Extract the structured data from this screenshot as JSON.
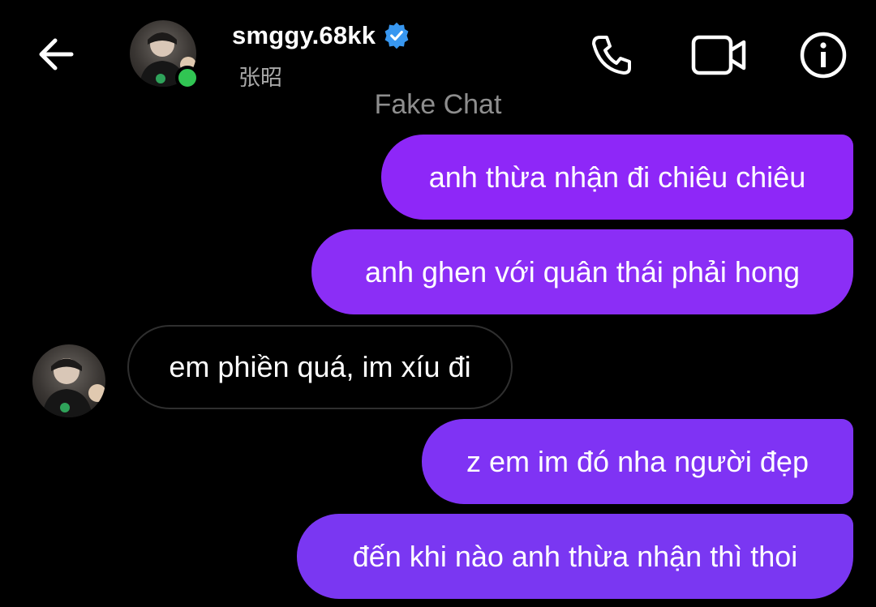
{
  "header": {
    "username": "smggy.68kk",
    "subname": "张昭",
    "back_icon": "arrow-left-icon",
    "call_icon": "phone-icon",
    "video_icon": "video-camera-icon",
    "info_icon": "info-icon",
    "verified_icon": "verified-badge-icon",
    "online": true
  },
  "watermark": "Fake Chat",
  "messages": [
    {
      "direction": "outgoing",
      "text": "anh thừa nhận đi chiêu chiêu"
    },
    {
      "direction": "outgoing",
      "text": "anh ghen với quân thái phải hong"
    },
    {
      "direction": "incoming",
      "text": "em phiền quá, im xíu đi"
    },
    {
      "direction": "outgoing",
      "text": "z em im đó nha người đẹp"
    },
    {
      "direction": "outgoing",
      "text": "đến khi nào anh thừa nhận thì thoi"
    }
  ],
  "colors": {
    "background": "#000000",
    "outgoing_bubble": "#8b2cf5",
    "incoming_border": "#2f2f2f",
    "online_dot": "#31c553",
    "verified": "#3897f0",
    "muted_text": "#8e8e8e"
  }
}
